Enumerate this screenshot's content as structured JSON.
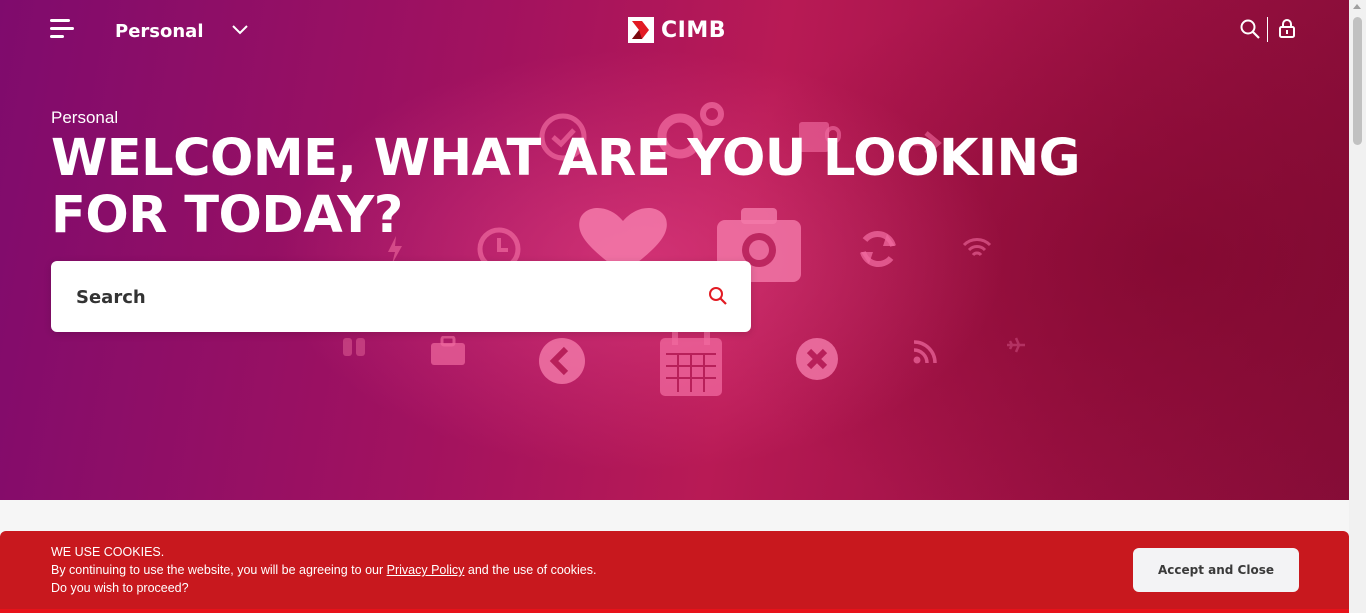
{
  "header": {
    "segment_label": "Personal",
    "brand_name": "CIMB",
    "icons": {
      "menu": "menu-icon",
      "segment_dropdown": "chevron-down-icon",
      "search": "search-icon",
      "login": "lock-icon"
    }
  },
  "hero": {
    "eyebrow": "Personal",
    "headline": "WELCOME, WHAT ARE YOU LOOKING FOR TODAY?",
    "search_placeholder": "Search",
    "search_icon": "search-icon"
  },
  "cookie_banner": {
    "title": "WE USE COOKIES.",
    "text_before_link": "By continuing to use the website, you will be agreeing to our ",
    "link_label": "Privacy Policy",
    "text_after_link": " and the use of cookies.",
    "question": "Do you wish to proceed?",
    "accept_label": "Accept and Close"
  },
  "colors": {
    "brand_red": "#c8181e",
    "hero_magenta": "#a2125f",
    "hero_crimson": "#870d38"
  }
}
